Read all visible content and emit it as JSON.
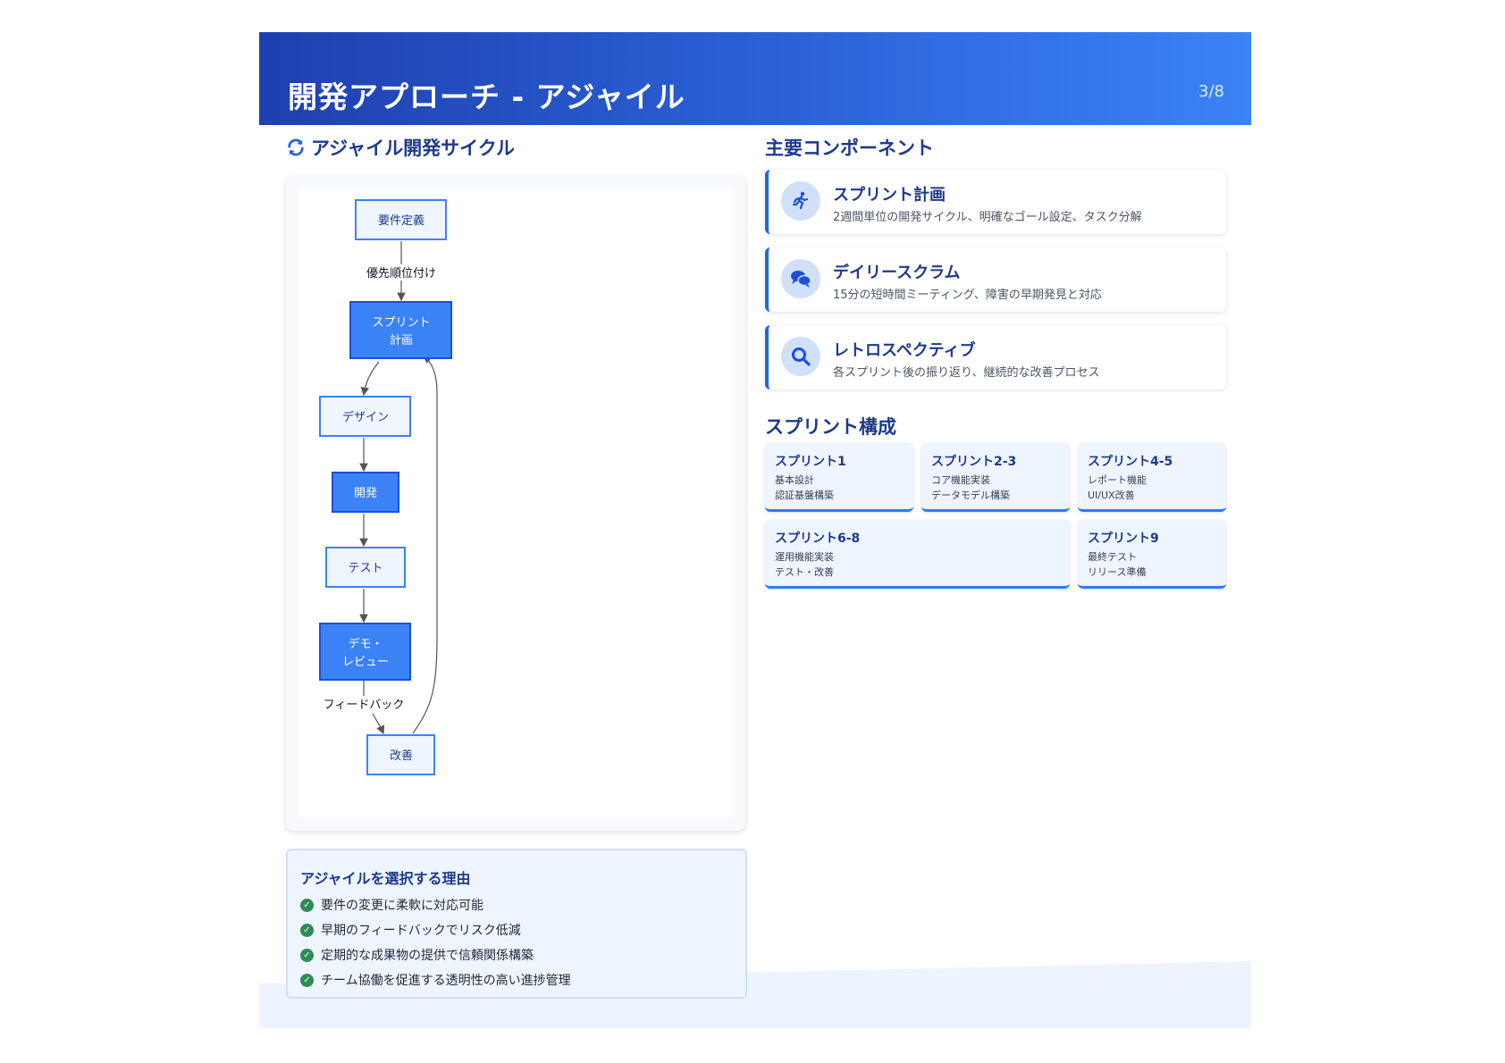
{
  "header": {
    "title": "開発アプローチ - アジャイル",
    "page": "3/8"
  },
  "cycle": {
    "title": "アジャイル開発サイクル",
    "nodes": {
      "requirements": "要件定義",
      "sprint_planning": [
        "スプリント",
        "計画"
      ],
      "design": "デザイン",
      "development": "開発",
      "test": "テスト",
      "demo_review": [
        "デモ・",
        "レビュー"
      ],
      "improvement": "改善"
    },
    "edges": {
      "prioritize": "優先順位付け",
      "feedback": "フィードバック"
    }
  },
  "reasons": {
    "title": "アジャイルを選択する理由",
    "items": [
      "要件の変更に柔軟に対応可能",
      "早期のフィードバックでリスク低減",
      "定期的な成果物の提供で信頼関係構築",
      "チーム協働を促進する透明性の高い進捗管理"
    ]
  },
  "components": {
    "title": "主要コンポーネント",
    "items": [
      {
        "icon": "running-person-icon",
        "title": "スプリント計画",
        "desc": "2週間単位の開発サイクル、明確なゴール設定、タスク分解"
      },
      {
        "icon": "chat-bubbles-icon",
        "title": "デイリースクラム",
        "desc": "15分の短時間ミーティング、障害の早期発見と対応"
      },
      {
        "icon": "magnifier-icon",
        "title": "レトロスペクティブ",
        "desc": "各スプリント後の振り返り、継続的な改善プロセス"
      }
    ]
  },
  "sprints": {
    "title": "スプリント構成",
    "items": [
      {
        "title": "スプリント1",
        "lines": [
          "基本設計",
          "認証基盤構築"
        ]
      },
      {
        "title": "スプリント2-3",
        "lines": [
          "コア機能実装",
          "データモデル構築"
        ]
      },
      {
        "title": "スプリント4-5",
        "lines": [
          "レポート機能",
          "UI/UX改善"
        ]
      },
      {
        "title": "スプリント6-8",
        "lines": [
          "運用機能実装",
          "テスト・改善"
        ]
      },
      {
        "title": "スプリント9",
        "lines": [
          "最終テスト",
          "リリース準備"
        ]
      }
    ]
  },
  "colors": {
    "primary": "#1e40af",
    "accent": "#3b82f6",
    "node_fill_dark": "#3b82f6",
    "node_fill_light": "#eff6ff",
    "check": "#2e8b57"
  }
}
